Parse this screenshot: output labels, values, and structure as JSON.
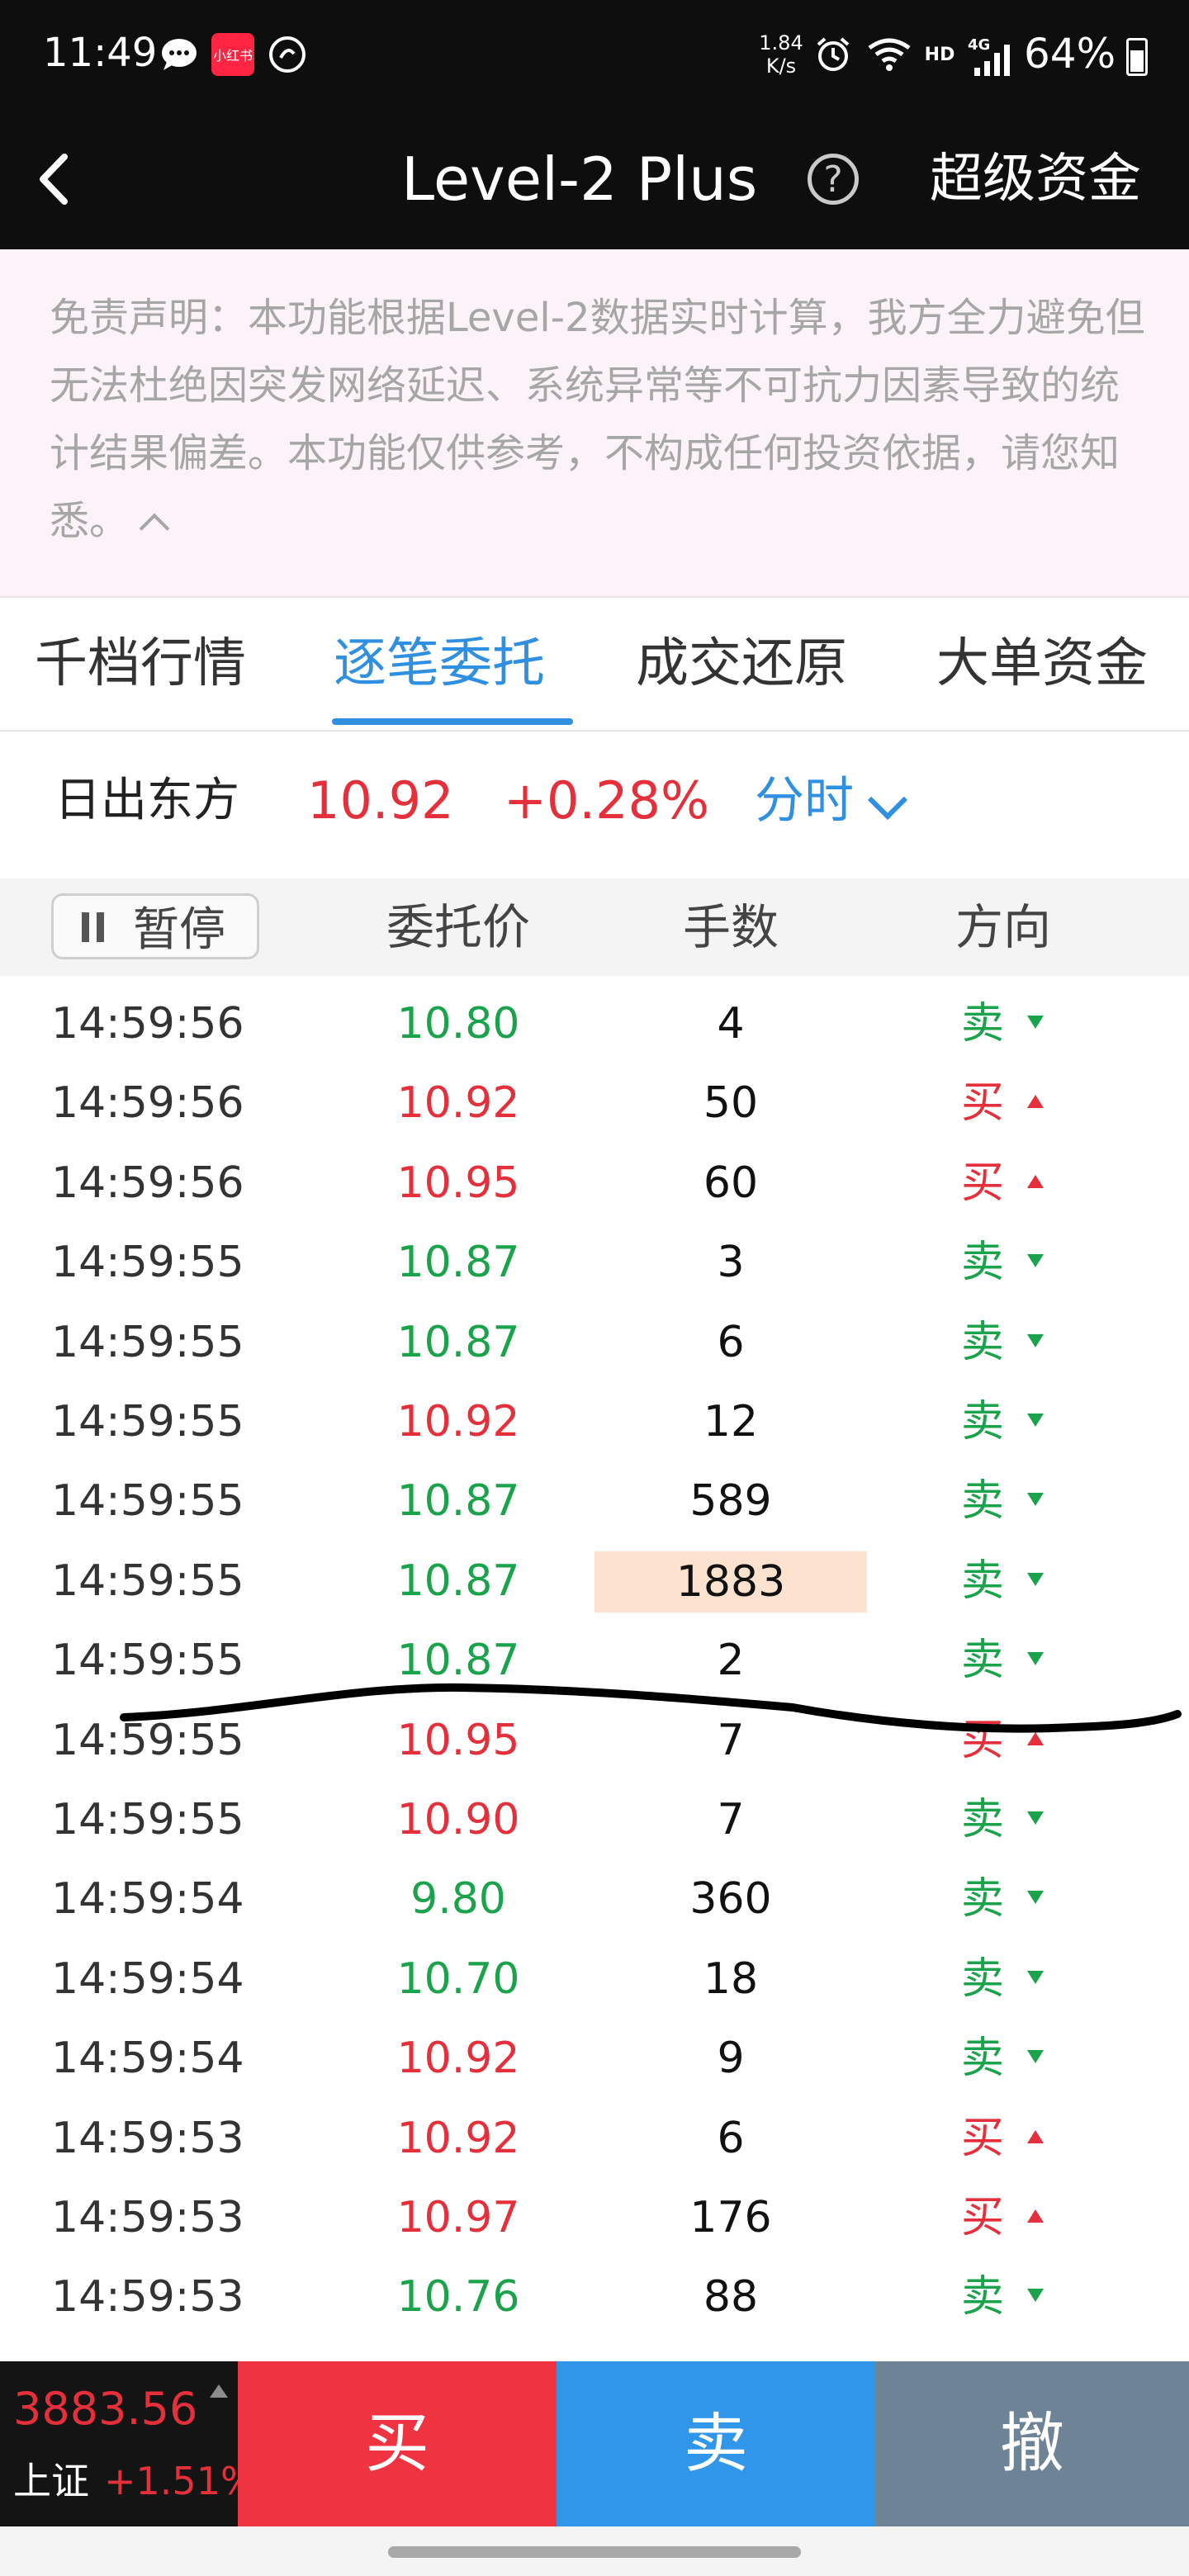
{
  "status_bar": {
    "time": "11:49",
    "app_badge": "小红书",
    "net_speed_value": "1.84",
    "net_speed_unit": "K/s",
    "hd": "HD",
    "signal": "4G",
    "battery": "64%",
    "battery_level": 0.64
  },
  "nav": {
    "title": "Level-2 Plus",
    "help": "?",
    "right_label": "超级资金"
  },
  "disclaimer": {
    "text": "免责声明：本功能根据Level-2数据实时计算，我方全力避免但无法杜绝因突发网络延迟、系统异常等不可抗力因素导致的统计结果偏差。本功能仅供参考，不构成任何投资依据，请您知悉。"
  },
  "tabs": [
    {
      "label": "千档行情",
      "active": false
    },
    {
      "label": "逐笔委托",
      "active": true
    },
    {
      "label": "成交还原",
      "active": false
    },
    {
      "label": "大单资金",
      "active": false
    }
  ],
  "stock": {
    "name": "日出东方",
    "price": "10.92",
    "change": "+0.28%",
    "mode": "分时"
  },
  "table": {
    "pause_label": "暂停",
    "col_price": "委托价",
    "col_qty": "手数",
    "col_dir": "方向",
    "rows": [
      {
        "time": "14:59:56",
        "price": "10.80",
        "qty": "4",
        "dir": "卖",
        "price_color": "green",
        "dir_color": "green",
        "highlight": false
      },
      {
        "time": "14:59:56",
        "price": "10.92",
        "qty": "50",
        "dir": "买",
        "price_color": "red",
        "dir_color": "red",
        "highlight": false
      },
      {
        "time": "14:59:56",
        "price": "10.95",
        "qty": "60",
        "dir": "买",
        "price_color": "red",
        "dir_color": "red",
        "highlight": false
      },
      {
        "time": "14:59:55",
        "price": "10.87",
        "qty": "3",
        "dir": "卖",
        "price_color": "green",
        "dir_color": "green",
        "highlight": false
      },
      {
        "time": "14:59:55",
        "price": "10.87",
        "qty": "6",
        "dir": "卖",
        "price_color": "green",
        "dir_color": "green",
        "highlight": false
      },
      {
        "time": "14:59:55",
        "price": "10.92",
        "qty": "12",
        "dir": "卖",
        "price_color": "red",
        "dir_color": "green",
        "highlight": false
      },
      {
        "time": "14:59:55",
        "price": "10.87",
        "qty": "589",
        "dir": "卖",
        "price_color": "green",
        "dir_color": "green",
        "highlight": false
      },
      {
        "time": "14:59:55",
        "price": "10.87",
        "qty": "1883",
        "dir": "卖",
        "price_color": "green",
        "dir_color": "green",
        "highlight": true
      },
      {
        "time": "14:59:55",
        "price": "10.87",
        "qty": "2",
        "dir": "卖",
        "price_color": "green",
        "dir_color": "green",
        "highlight": false
      },
      {
        "time": "14:59:55",
        "price": "10.95",
        "qty": "7",
        "dir": "买",
        "price_color": "red",
        "dir_color": "red",
        "highlight": false
      },
      {
        "time": "14:59:55",
        "price": "10.90",
        "qty": "7",
        "dir": "卖",
        "price_color": "red",
        "dir_color": "green",
        "highlight": false
      },
      {
        "time": "14:59:54",
        "price": "9.80",
        "qty": "360",
        "dir": "卖",
        "price_color": "green",
        "dir_color": "green",
        "highlight": false
      },
      {
        "time": "14:59:54",
        "price": "10.70",
        "qty": "18",
        "dir": "卖",
        "price_color": "green",
        "dir_color": "green",
        "highlight": false
      },
      {
        "time": "14:59:54",
        "price": "10.92",
        "qty": "9",
        "dir": "卖",
        "price_color": "red",
        "dir_color": "green",
        "highlight": false
      },
      {
        "time": "14:59:53",
        "price": "10.92",
        "qty": "6",
        "dir": "买",
        "price_color": "red",
        "dir_color": "red",
        "highlight": false
      },
      {
        "time": "14:59:53",
        "price": "10.97",
        "qty": "176",
        "dir": "买",
        "price_color": "red",
        "dir_color": "red",
        "highlight": false
      },
      {
        "time": "14:59:53",
        "price": "10.76",
        "qty": "88",
        "dir": "卖",
        "price_color": "green",
        "dir_color": "green",
        "highlight": false
      }
    ]
  },
  "index": {
    "value": "3883.56",
    "name": "上证",
    "change": "+1.51%"
  },
  "actions": {
    "buy": "买",
    "sell": "卖",
    "cancel": "撤"
  },
  "colors": {
    "red": "#e5303b",
    "green": "#1aa34a",
    "blue": "#2f8fe0",
    "buy_button": "#ef3340",
    "sell_button": "#2f96ea",
    "cancel_button": "#6f8396"
  }
}
